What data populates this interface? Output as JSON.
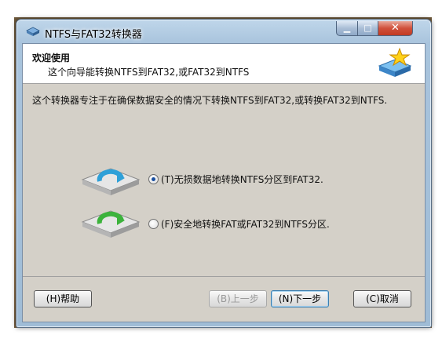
{
  "window": {
    "title": "NTFS与FAT32转换器"
  },
  "header": {
    "title": "欢迎使用",
    "subtitle": "这个向导能转换NTFS到FAT32,或FAT32到NTFS"
  },
  "body": {
    "intro": "这个转换器专注于在确保数据安全的情况下转换NTFS到FAT32,或转换FAT32到NTFS.",
    "options": [
      {
        "label": "(T)无损数据地转换NTFS分区到FAT32.",
        "checked": true,
        "arrow_color": "#2fa0d8"
      },
      {
        "label": "(F)安全地转换FAT或FAT32到NTFS分区.",
        "checked": false,
        "arrow_color": "#3cb33c"
      }
    ]
  },
  "buttons": {
    "help": "(H)帮助",
    "back": "(B)上一步",
    "next": "(N)下一步",
    "cancel": "(C)取消"
  }
}
